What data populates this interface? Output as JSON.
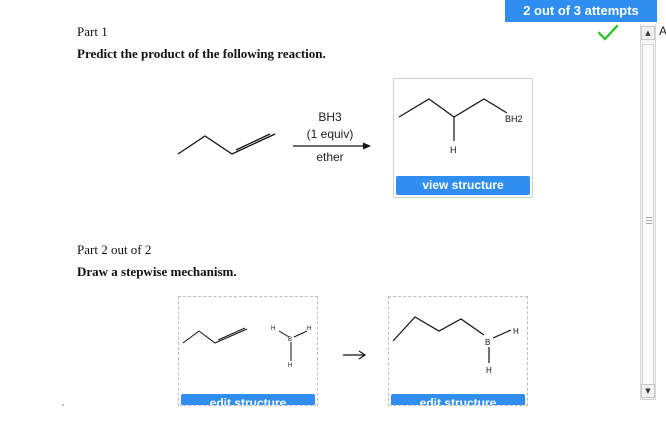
{
  "header": {
    "attempts_label": "2 out of 3 attempts",
    "edge_letter": "A"
  },
  "part1": {
    "title": "Part 1",
    "prompt": "Predict the product of the following reaction.",
    "reagent_line1": "BH3",
    "reagent_line2": "(1 equiv)",
    "reagent_solvent": "ether",
    "product_labels": {
      "bh2": "BH2",
      "h": "H"
    },
    "view_button_label": "view structure"
  },
  "part2": {
    "title": "Part 2 out of 2",
    "prompt": "Draw a stepwise mechanism.",
    "box1_atom_labels": {
      "h1": "H",
      "h2": "H",
      "b": "B",
      "h3": "H"
    },
    "box2_atom_labels": {
      "b": "B",
      "h_right": "H",
      "h_bottom": "H"
    },
    "edit_button_label": "edit structure"
  },
  "colors": {
    "accent": "#2f8ef0",
    "check": "#35c435",
    "dashed_border": "#bdbdbd"
  },
  "icons": {
    "status": "checkmark-icon",
    "scroll_up": "up-arrow-icon",
    "scroll_down": "down-arrow-icon",
    "step_arrow": "reaction-arrow-icon"
  }
}
